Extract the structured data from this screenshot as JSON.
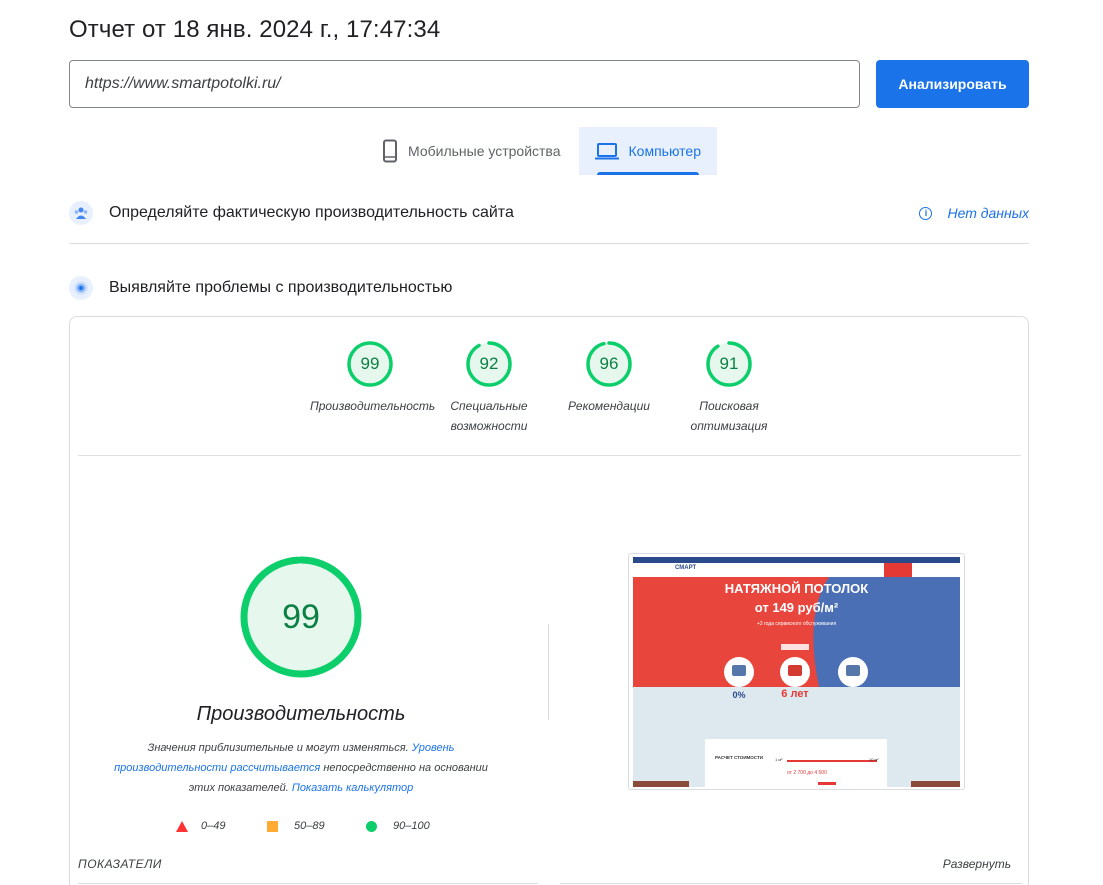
{
  "header": {
    "title": "Отчет от 18 янв. 2024 г., 17:47:34"
  },
  "url_bar": {
    "value": "https://www.smartpotolki.ru/",
    "button_label": "Анализировать"
  },
  "tabs": [
    {
      "label": "Мобильные устройства",
      "active": false
    },
    {
      "label": "Компьютер",
      "active": true
    }
  ],
  "field_data": {
    "title": "Определяйте фактическую производительность сайта",
    "status": "Нет данных"
  },
  "lab_data": {
    "title": "Выявляйте проблемы с производительностью"
  },
  "scores": [
    {
      "value": "99",
      "label_line1": "Производительность",
      "label_line2": "",
      "fraction": 0.99
    },
    {
      "value": "92",
      "label_line1": "Специальные",
      "label_line2": "возможности",
      "fraction": 0.92
    },
    {
      "value": "96",
      "label_line1": "Рекомендации",
      "label_line2": "",
      "fraction": 0.96
    },
    {
      "value": "91",
      "label_line1": "Поисковая",
      "label_line2": "оптимизация",
      "fraction": 0.91
    }
  ],
  "performance": {
    "score": "99",
    "fraction": 0.99,
    "title": "Производительность",
    "desc_prefix": "Значения приблизительные и могут изменяться.",
    "desc_link1": "Уровень производительности рассчитывается",
    "desc_middle": "непосредственно на основании этих показателей.",
    "desc_link2": "Показать калькулятор"
  },
  "legend": {
    "poor": "0–49",
    "average": "50–89",
    "good": "90–100"
  },
  "screenshot": {
    "headline1": "НАТЯЖНОЙ ПОТОЛОК",
    "headline2": "от 149 руб/м²",
    "sub": "+3 года сервисного обслуживания",
    "logo": "СМАРТ",
    "stat1": "0%",
    "stat2": "6 лет",
    "calc_title": "РАСЧЕТ СТОИМОСТИ",
    "calc_range": "от 2 700 до 4 500",
    "calc_min": "1 м²",
    "calc_max": "10 м²"
  },
  "metrics": {
    "label": "ПОКАЗАТЕЛИ",
    "expand": "Развернуть"
  },
  "colors": {
    "accent": "#1a73e8",
    "pass": "#0cce6b",
    "pass_text": "#0b8043",
    "pass_fill": "#e6f8ed",
    "fail": "#ff3333",
    "average": "#ffaa33"
  }
}
